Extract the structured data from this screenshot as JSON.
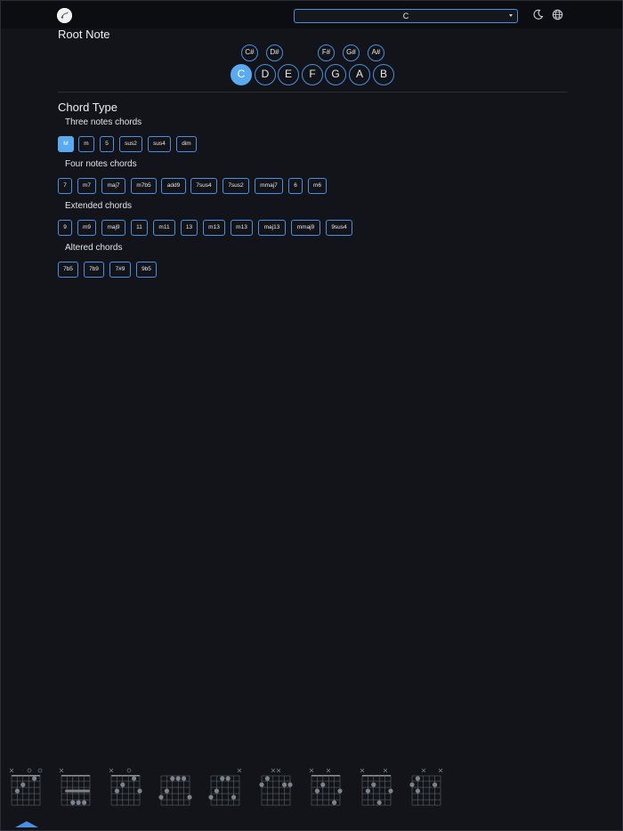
{
  "header": {
    "selected_key": "C",
    "icons": [
      "moon-icon",
      "globe-icon"
    ]
  },
  "root_note": {
    "title": "Root Note",
    "sharps": [
      "C#",
      "D#",
      "F#",
      "G#",
      "A#"
    ],
    "naturals": [
      "C",
      "D",
      "E",
      "F",
      "G",
      "A",
      "B"
    ],
    "selected": "C"
  },
  "chord_type": {
    "title": "Chord Type",
    "groups": [
      {
        "label": "Three notes chords",
        "chords": [
          "M",
          "m",
          "5",
          "sus2",
          "sus4",
          "dim"
        ]
      },
      {
        "label": "Four notes chords",
        "chords": [
          "7",
          "m7",
          "maj7",
          "m7b5",
          "add9",
          "7sus4",
          "7sus2",
          "mmaj7",
          "6",
          "m6"
        ]
      },
      {
        "label": "Extended chords",
        "chords": [
          "9",
          "m9",
          "maj9",
          "11",
          "m11",
          "13",
          "m13",
          "m13",
          "maj13",
          "mmaj9",
          "9sus4"
        ]
      },
      {
        "label": "Altered chords",
        "chords": [
          "7b5",
          "7b9",
          "7#9",
          "9b5"
        ]
      }
    ],
    "selected": "M"
  },
  "colors": {
    "accent": "#4a90e2",
    "active": "#5aaaf2",
    "background": "#121419"
  }
}
